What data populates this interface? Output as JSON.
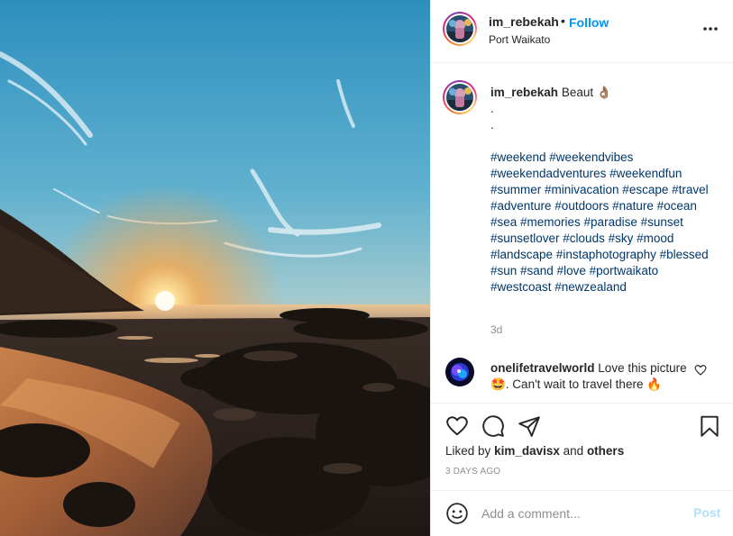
{
  "post": {
    "username": "im_rebekah",
    "follow_label": "Follow",
    "separator": "•",
    "location": "Port Waikato"
  },
  "caption": {
    "username": "im_rebekah",
    "text": "Beaut",
    "emoji": "👌🏽",
    "dot1": ".",
    "dot2": ".",
    "hashtags": "#weekend #weekendvibes #weekendadventures #weekendfun #summer #minivacation #escape #travel #adventure #outdoors #nature #ocean #sea #memories #paradise #sunset #sunsetlover #clouds #sky #mood #landscape #instaphotography #blessed #sun #sand #love #portwaikato #westcoast #newzealand",
    "age": "3d"
  },
  "comment": {
    "username": "onelifetravelworld",
    "text": "Love this picture 🤩. Can't wait to travel there 🔥"
  },
  "likes": {
    "prefix": "Liked by",
    "user": "kim_davisx",
    "joiner": "and",
    "others": "others"
  },
  "date": "3 DAYS AGO",
  "add_comment": {
    "placeholder": "Add a comment...",
    "post_label": "Post"
  },
  "icons": [
    "more-icon",
    "heart-icon",
    "comment-icon",
    "share-icon",
    "save-icon",
    "smile-icon"
  ],
  "colors": {
    "accent": "#0095f6",
    "hashtag": "#00376b",
    "muted": "#8e8e8e",
    "post_disabled": "#b2dffc",
    "border": "#efefef"
  }
}
